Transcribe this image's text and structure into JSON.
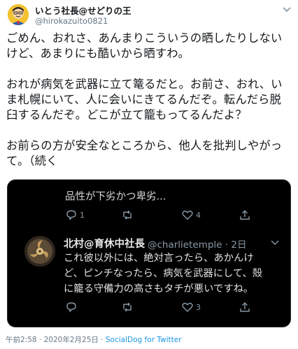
{
  "author": {
    "name": "いとう社長@せどりの王",
    "handle": "@hirokazuito0821",
    "avatar_icon": "avatar-illustration"
  },
  "tweet_lines": [
    "ごめん、おれさ、あんまりこういうの晒したりしない",
    "けど、あまりにも酷いから晒すわ。",
    "",
    "おれが病気を武器に立て篭るだと。お前さ、おれ、い",
    "ま札幌にいて、人に会いにきてるんだぞ。転んだら脱",
    "臼するんだぞ。どこが立て籠もってるんだよ？",
    "",
    "お前らの方が安全なところから、他人を批判しやがっ",
    "て。（続く"
  ],
  "embed": {
    "top_text": "品性が下劣かつ卑劣...",
    "top_actions": {
      "reply_count": "1",
      "retweet_count": "",
      "like_count": "4"
    },
    "reply": {
      "name": "北村@育休中社長",
      "handle": "@charlietemple · 2日",
      "lines": [
        "これ彼以外には、絶対言ったら、あかんけ",
        "ど、ピンチなったら、病気を武器にして、殻",
        "に籠る守備力の高さもタチが悪いですね。"
      ]
    },
    "bottom_actions": {
      "reply_count": "",
      "retweet_count": "",
      "like_count": "3"
    },
    "colors": {
      "background": "#000000",
      "text": "#e1e1e1",
      "muted": "#8899a6"
    }
  },
  "footer": {
    "time": "午前2:58",
    "separator1": " · ",
    "date": "2020年2月25日",
    "separator2": " · ",
    "source": "SocialDog for Twitter"
  },
  "colors": {
    "link": "#1b95e0",
    "muted": "#657786",
    "text": "#14171a"
  }
}
